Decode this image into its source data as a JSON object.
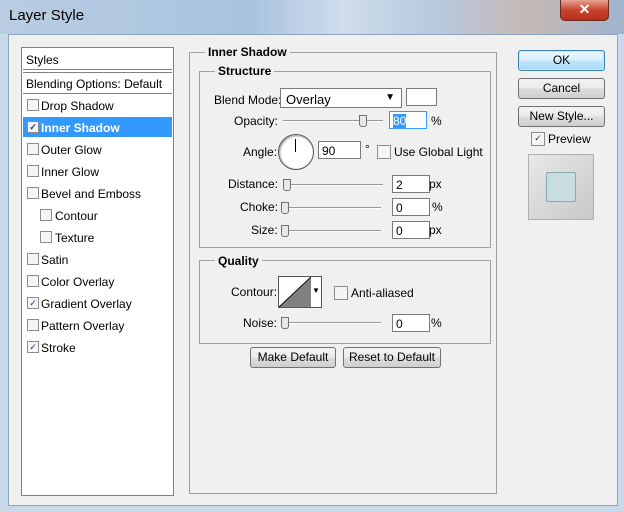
{
  "window": {
    "title": "Layer Style",
    "close_label": "x"
  },
  "styles_panel": {
    "header": "Styles",
    "blending_options": "Blending Options: Default",
    "items": [
      {
        "label": "Drop Shadow",
        "checked": false,
        "selected": false,
        "indent": false
      },
      {
        "label": "Inner Shadow",
        "checked": true,
        "selected": true,
        "indent": false
      },
      {
        "label": "Outer Glow",
        "checked": false,
        "selected": false,
        "indent": false
      },
      {
        "label": "Inner Glow",
        "checked": false,
        "selected": false,
        "indent": false
      },
      {
        "label": "Bevel and Emboss",
        "checked": false,
        "selected": false,
        "indent": false
      },
      {
        "label": "Contour",
        "checked": false,
        "selected": false,
        "indent": true
      },
      {
        "label": "Texture",
        "checked": false,
        "selected": false,
        "indent": true
      },
      {
        "label": "Satin",
        "checked": false,
        "selected": false,
        "indent": false
      },
      {
        "label": "Color Overlay",
        "checked": false,
        "selected": false,
        "indent": false
      },
      {
        "label": "Gradient Overlay",
        "checked": true,
        "selected": false,
        "indent": false
      },
      {
        "label": "Pattern Overlay",
        "checked": false,
        "selected": false,
        "indent": false
      },
      {
        "label": "Stroke",
        "checked": true,
        "selected": false,
        "indent": false
      }
    ]
  },
  "inner_shadow": {
    "section_title": "Inner Shadow",
    "structure": {
      "title": "Structure",
      "blend_mode_label": "Blend Mode:",
      "blend_mode_value": "Overlay",
      "blend_color": "#ffffff",
      "opacity_label": "Opacity:",
      "opacity_value": "80",
      "opacity_unit": "%",
      "opacity_fraction": 0.8,
      "angle_label": "Angle:",
      "angle_value": "90",
      "angle_unit": "°",
      "use_global_light_label": "Use Global Light",
      "use_global_light_checked": false,
      "distance_label": "Distance:",
      "distance_value": "2",
      "distance_unit": "px",
      "choke_label": "Choke:",
      "choke_value": "0",
      "choke_unit": "%",
      "size_label": "Size:",
      "size_value": "0",
      "size_unit": "px"
    },
    "quality": {
      "title": "Quality",
      "contour_label": "Contour:",
      "anti_aliased_label": "Anti-aliased",
      "anti_aliased_checked": false,
      "noise_label": "Noise:",
      "noise_value": "0",
      "noise_unit": "%"
    },
    "make_default_label": "Make Default",
    "reset_default_label": "Reset to Default"
  },
  "actions": {
    "ok_label": "OK",
    "cancel_label": "Cancel",
    "new_style_label": "New Style...",
    "preview_label": "Preview",
    "preview_checked": true
  },
  "colors": {
    "selection": "#3399ff",
    "preview_swatch": "#c7dde0"
  }
}
